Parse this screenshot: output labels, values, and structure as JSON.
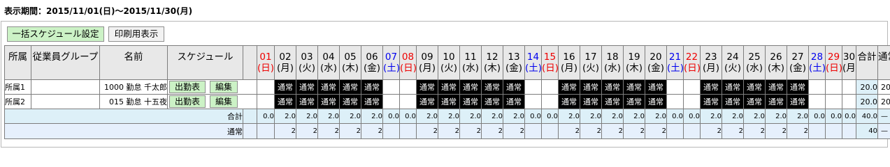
{
  "period": "表示期間：2015/11/01(日)～2015/11/30(月)",
  "buttons": {
    "bulk": "一括スケジュール設定",
    "print": "印刷用表示"
  },
  "headers": {
    "affiliation": "所属",
    "group": "従業員グループ",
    "name": "名前",
    "schedule": "スケジュール",
    "total": "合計",
    "normal": "通常"
  },
  "days": [
    {
      "num": "01",
      "dow": "(日)",
      "type": "sun"
    },
    {
      "num": "02",
      "dow": "(月)",
      "type": "wd"
    },
    {
      "num": "03",
      "dow": "(火)",
      "type": "wd"
    },
    {
      "num": "04",
      "dow": "(水)",
      "type": "wd"
    },
    {
      "num": "05",
      "dow": "(木)",
      "type": "wd"
    },
    {
      "num": "06",
      "dow": "(金)",
      "type": "wd"
    },
    {
      "num": "07",
      "dow": "(土)",
      "type": "sat"
    },
    {
      "num": "08",
      "dow": "(日)",
      "type": "sun"
    },
    {
      "num": "09",
      "dow": "(月)",
      "type": "wd"
    },
    {
      "num": "10",
      "dow": "(火)",
      "type": "wd"
    },
    {
      "num": "11",
      "dow": "(水)",
      "type": "wd"
    },
    {
      "num": "12",
      "dow": "(木)",
      "type": "wd"
    },
    {
      "num": "13",
      "dow": "(金)",
      "type": "wd"
    },
    {
      "num": "14",
      "dow": "(土)",
      "type": "sat"
    },
    {
      "num": "15",
      "dow": "(日)",
      "type": "sun"
    },
    {
      "num": "16",
      "dow": "(月)",
      "type": "wd"
    },
    {
      "num": "17",
      "dow": "(火)",
      "type": "wd"
    },
    {
      "num": "18",
      "dow": "(水)",
      "type": "wd"
    },
    {
      "num": "19",
      "dow": "(木)",
      "type": "wd"
    },
    {
      "num": "20",
      "dow": "(金)",
      "type": "wd"
    },
    {
      "num": "21",
      "dow": "(土)",
      "type": "sat"
    },
    {
      "num": "22",
      "dow": "(日)",
      "type": "sun"
    },
    {
      "num": "23",
      "dow": "(月)",
      "type": "wd"
    },
    {
      "num": "24",
      "dow": "(火)",
      "type": "wd"
    },
    {
      "num": "25",
      "dow": "(水)",
      "type": "wd"
    },
    {
      "num": "26",
      "dow": "(木)",
      "type": "wd"
    },
    {
      "num": "27",
      "dow": "(金)",
      "type": "wd"
    },
    {
      "num": "28",
      "dow": "(土)",
      "type": "sat"
    },
    {
      "num": "29",
      "dow": "(日)",
      "type": "sun"
    },
    {
      "num": "30",
      "dow": "(月)",
      "type": "wd"
    }
  ],
  "row_buttons": {
    "attendance": "出勤表",
    "edit": "編集"
  },
  "employees": [
    {
      "affiliation": "所属1",
      "group": "",
      "name": "1000 勤怠 千太郎",
      "shifts": [
        "",
        "通常",
        "通常",
        "通常",
        "通常",
        "通常",
        "",
        "",
        "通常",
        "通常",
        "通常",
        "通常",
        "通常",
        "",
        "",
        "通常",
        "通常",
        "通常",
        "通常",
        "通常",
        "",
        "",
        "通常",
        "通常",
        "通常",
        "通常",
        "通常",
        "",
        "",
        ""
      ],
      "total": "20.0",
      "normal": "20"
    },
    {
      "affiliation": "所属2",
      "group": "",
      "name": "015 勤怠 十五夜",
      "shifts": [
        "",
        "通常",
        "通常",
        "通常",
        "通常",
        "通常",
        "",
        "",
        "通常",
        "通常",
        "通常",
        "通常",
        "通常",
        "",
        "",
        "通常",
        "通常",
        "通常",
        "通常",
        "通常",
        "",
        "",
        "通常",
        "通常",
        "通常",
        "通常",
        "通常",
        "",
        "",
        ""
      ],
      "total": "20.0",
      "normal": "20"
    }
  ],
  "summary": {
    "label": "合計",
    "values": [
      "0.0",
      "2.0",
      "2.0",
      "2.0",
      "2.0",
      "2.0",
      "0.0",
      "0.0",
      "2.0",
      "2.0",
      "2.0",
      "2.0",
      "2.0",
      "0.0",
      "0.0",
      "2.0",
      "2.0",
      "2.0",
      "2.0",
      "2.0",
      "0.0",
      "0.0",
      "2.0",
      "2.0",
      "2.0",
      "2.0",
      "2.0",
      "0.0",
      "0.0",
      "0.0"
    ],
    "total": "40.0",
    "normal": "—"
  },
  "normal_row": {
    "label": "通常",
    "values": [
      "",
      "2",
      "2",
      "2",
      "2",
      "2",
      "",
      "",
      "2",
      "2",
      "2",
      "2",
      "2",
      "",
      "",
      "2",
      "2",
      "2",
      "2",
      "2",
      "",
      "",
      "2",
      "2",
      "2",
      "2",
      "2",
      "",
      "",
      ""
    ],
    "total": "40",
    "normal": "—"
  }
}
